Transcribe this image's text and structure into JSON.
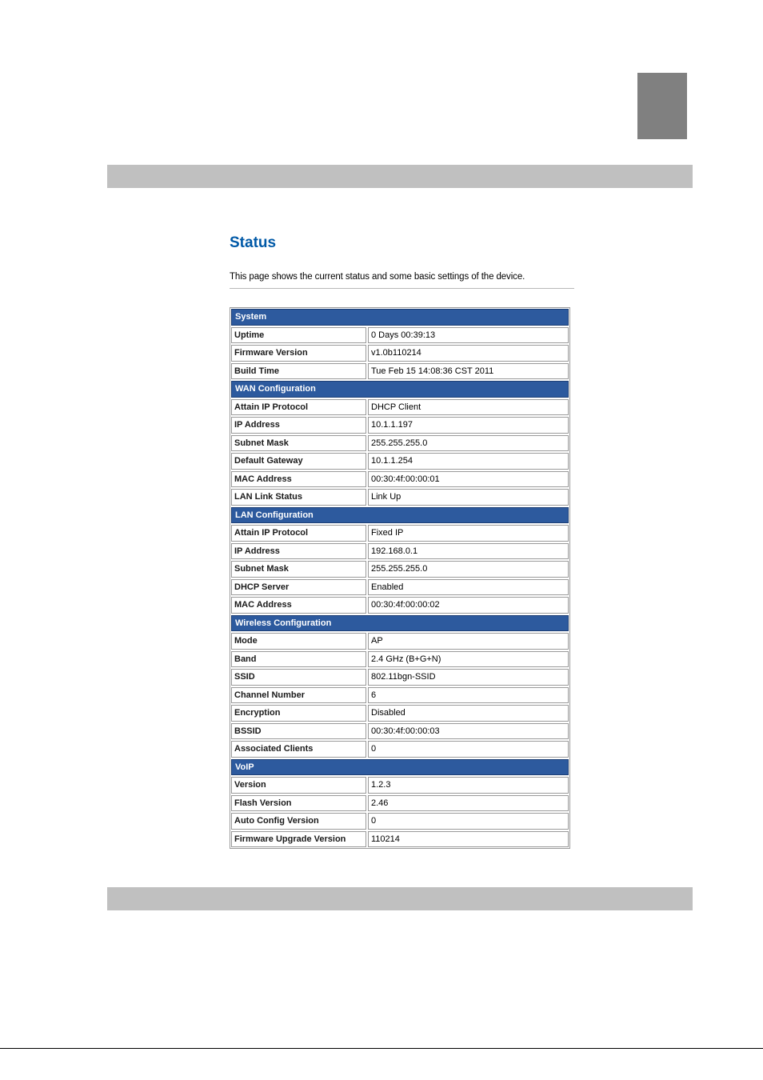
{
  "page": {
    "title": "Status",
    "description": "This page shows the current status and some basic settings of the device."
  },
  "sections": [
    {
      "header": "System",
      "rows": [
        {
          "label": "Uptime",
          "value": "0 Days 00:39:13"
        },
        {
          "label": "Firmware Version",
          "value": "v1.0b110214"
        },
        {
          "label": "Build Time",
          "value": "Tue Feb 15 14:08:36 CST 2011"
        }
      ]
    },
    {
      "header": "WAN Configuration",
      "rows": [
        {
          "label": "Attain IP Protocol",
          "value": "DHCP Client"
        },
        {
          "label": "IP Address",
          "value": "10.1.1.197"
        },
        {
          "label": "Subnet Mask",
          "value": "255.255.255.0"
        },
        {
          "label": "Default Gateway",
          "value": "10.1.1.254"
        },
        {
          "label": "MAC Address",
          "value": "00:30:4f:00:00:01"
        },
        {
          "label": "LAN Link Status",
          "value": "Link Up"
        }
      ]
    },
    {
      "header": "LAN Configuration",
      "rows": [
        {
          "label": "Attain IP Protocol",
          "value": "Fixed IP"
        },
        {
          "label": "IP Address",
          "value": "192.168.0.1"
        },
        {
          "label": "Subnet Mask",
          "value": "255.255.255.0"
        },
        {
          "label": "DHCP Server",
          "value": "Enabled"
        },
        {
          "label": "MAC Address",
          "value": "00:30:4f:00:00:02"
        }
      ]
    },
    {
      "header": "Wireless Configuration",
      "rows": [
        {
          "label": "Mode",
          "value": "AP"
        },
        {
          "label": "Band",
          "value": "2.4 GHz (B+G+N)"
        },
        {
          "label": "SSID",
          "value": "802.11bgn-SSID"
        },
        {
          "label": "Channel Number",
          "value": "6"
        },
        {
          "label": "Encryption",
          "value": "Disabled"
        },
        {
          "label": "BSSID",
          "value": "00:30:4f:00:00:03"
        },
        {
          "label": "Associated Clients",
          "value": "0"
        }
      ]
    },
    {
      "header": "VoIP",
      "rows": [
        {
          "label": "Version",
          "value": "1.2.3"
        },
        {
          "label": "Flash Version",
          "value": "2.46"
        },
        {
          "label": "Auto Config Version",
          "value": "0"
        },
        {
          "label": "Firmware Upgrade Version",
          "value": "110214"
        }
      ]
    }
  ],
  "colors": {
    "title": "#0059a7",
    "section_header_bg": "#2d5a9e",
    "gray_bar": "#c0c0c0",
    "tab_marker": "#808080"
  }
}
